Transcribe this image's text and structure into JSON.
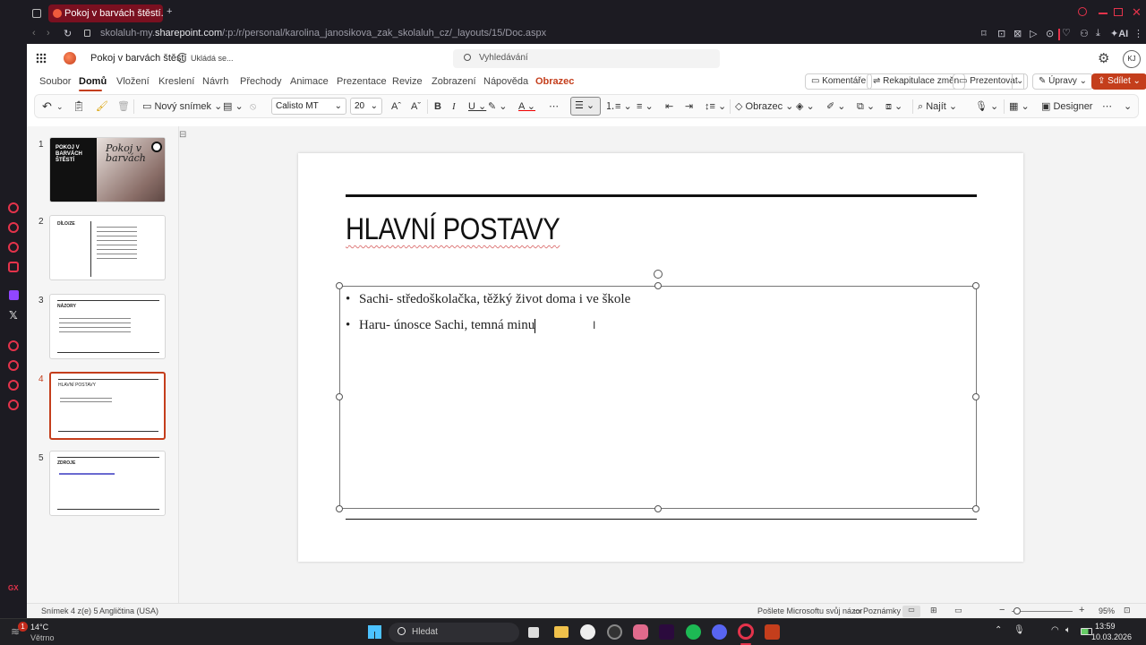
{
  "browser": {
    "tab_title": "Pokoj v barvách štěstí.pptx",
    "url_host": "skolaluh-my.sharepoint.com",
    "url_prefix": "skolaluh-my.",
    "url_domain": "sharepoint.com",
    "url_path": "/:p:/r/personal/karolina_janosikova_zak_skolaluh_cz/_layouts/15/Doc.aspx",
    "ai_label": "AI"
  },
  "app": {
    "doc_title": "Pokoj v barvách štěstí",
    "save_status": "Ukládá se...",
    "search_placeholder": "Vyhledávání",
    "avatar_initials": "KJ",
    "menu": [
      "Soubor",
      "Domů",
      "Vložení",
      "Kreslení",
      "Návrh",
      "Přechody",
      "Animace",
      "Prezentace",
      "Revize",
      "Zobrazení",
      "Nápověda",
      "Obrazec"
    ],
    "active_menu": "Domů",
    "buttons": {
      "comments": "Komentáře",
      "recap": "Rekapitulace změn",
      "present": "Prezentovat",
      "edit": "Úpravy",
      "share": "Sdílet"
    }
  },
  "ribbon": {
    "new_slide": "Nový snímek",
    "font_name": "Calisto MT",
    "font_size": "20",
    "shape": "Obrazec",
    "find": "Najít",
    "designer": "Designer"
  },
  "thumbnails": [
    {
      "num": "1",
      "title_lines": [
        "POKOJ V",
        "BARVÁCH",
        "ŠTĚSTÍ"
      ],
      "script_title": "Pokoj v barvách"
    },
    {
      "num": "2",
      "title": "DÍLO/ZE"
    },
    {
      "num": "3",
      "title": "NÁZORY"
    },
    {
      "num": "4",
      "title": "HLAVNÍ POSTAVY"
    },
    {
      "num": "5",
      "title": "ZDROJE"
    }
  ],
  "slide": {
    "title": "HLAVNÍ POSTAVY",
    "bullets": [
      "Sachi- středoškolačka, těžký život doma i ve škole",
      "Haru- únosce Sachi, temná minu"
    ]
  },
  "status": {
    "slide_info": "Snímek 4 z(e) 5",
    "language": "Angličtina (USA)",
    "feedback": "Pošlete Microsoftu svůj názor",
    "notes": "Poznámky",
    "zoom": "95%"
  },
  "taskbar": {
    "weather_temp": "14°C",
    "weather_desc": "Větrno",
    "search": "Hledat",
    "time": "13:59",
    "date": "10.03.2026",
    "badge": "1"
  },
  "colors": {
    "accent": "#c43e1c",
    "opera_red": "#e4334b",
    "share_bg": "#c43e1c"
  }
}
